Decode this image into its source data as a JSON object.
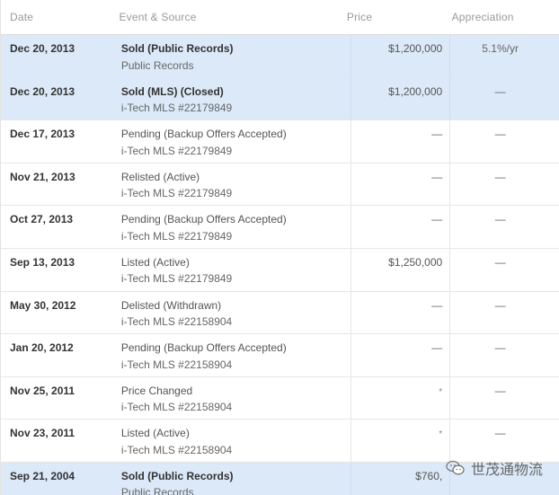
{
  "header": {
    "date": "Date",
    "event": "Event & Source",
    "price": "Price",
    "appreciation": "Appreciation"
  },
  "rows": [
    {
      "date": "Dec 20, 2013",
      "event": "Sold (Public Records)",
      "source": "Public Records",
      "price": "$1,200,000",
      "appreciation": "5.1%/yr",
      "highlight": true
    },
    {
      "date": "Dec 20, 2013",
      "event": "Sold (MLS) (Closed)",
      "source": "i-Tech MLS #22179849",
      "price": "$1,200,000",
      "appreciation": "—",
      "highlight": true
    },
    {
      "date": "Dec 17, 2013",
      "event": "Pending (Backup Offers Accepted)",
      "source": "i-Tech MLS #22179849",
      "price": "—",
      "appreciation": "—",
      "highlight": false
    },
    {
      "date": "Nov 21, 2013",
      "event": "Relisted (Active)",
      "source": "i-Tech MLS #22179849",
      "price": "—",
      "appreciation": "—",
      "highlight": false
    },
    {
      "date": "Oct 27, 2013",
      "event": "Pending (Backup Offers Accepted)",
      "source": "i-Tech MLS #22179849",
      "price": "—",
      "appreciation": "—",
      "highlight": false
    },
    {
      "date": "Sep 13, 2013",
      "event": "Listed (Active)",
      "source": "i-Tech MLS #22179849",
      "price": "$1,250,000",
      "appreciation": "—",
      "highlight": false
    },
    {
      "date": "May 30, 2012",
      "event": "Delisted (Withdrawn)",
      "source": "i-Tech MLS #22158904",
      "price": "—",
      "appreciation": "—",
      "highlight": false
    },
    {
      "date": "Jan 20, 2012",
      "event": "Pending (Backup Offers Accepted)",
      "source": "i-Tech MLS #22158904",
      "price": "—",
      "appreciation": "—",
      "highlight": false
    },
    {
      "date": "Nov 25, 2011",
      "event": "Price Changed",
      "source": "i-Tech MLS #22158904",
      "price": "*",
      "appreciation": "—",
      "highlight": false
    },
    {
      "date": "Nov 23, 2011",
      "event": "Listed (Active)",
      "source": "i-Tech MLS #22158904",
      "price": "*",
      "appreciation": "—",
      "highlight": false
    },
    {
      "date": "Sep 21, 2004",
      "event": "Sold (Public Records)",
      "source": "Public Records",
      "price": "$760,",
      "appreciation": "",
      "highlight": true
    }
  ],
  "watermark": {
    "text": "世茂通物流",
    "icon": "wechat-icon"
  }
}
